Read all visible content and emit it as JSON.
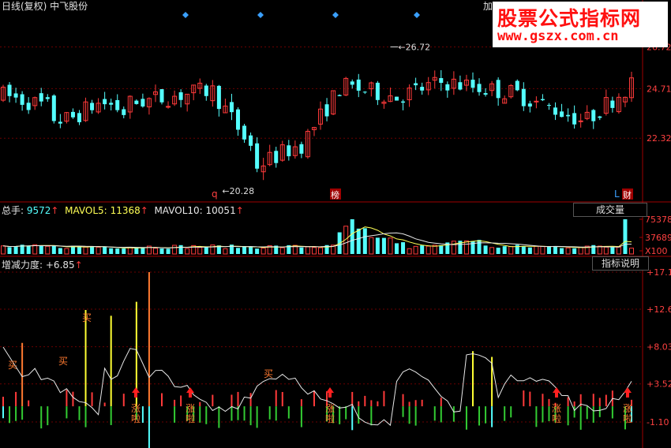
{
  "header": {
    "title": "日线(复权)  中飞股份",
    "zoom_prefix": "加"
  },
  "watermark": {
    "line1": "股票公式指标网",
    "line2": "www.gszx.com.cn"
  },
  "price_panel": {
    "y_ticks": [
      "26.72",
      "24.71",
      "22.32"
    ],
    "y_values": [
      26.72,
      24.71,
      22.32
    ],
    "high_marker": "26.72",
    "low_marker": "20.28",
    "event_markers": [
      "q",
      "榜",
      "L",
      "财"
    ],
    "colors": {
      "up": "#ff3a3a",
      "down": "#54ffff",
      "grid": "#7a0000"
    }
  },
  "volume_panel": {
    "legend_label": "总手:",
    "legend_value": "9572",
    "mavol5_label": "MAVOL5:",
    "mavol5_value": "11368",
    "mavol10_label": "MAVOL10:",
    "mavol10_value": "10051",
    "button_label": "成交量",
    "y_ticks": [
      "75378",
      "37689",
      "X100"
    ]
  },
  "indicator_panel": {
    "legend_label": "增减力度:",
    "legend_value": "+6.85",
    "button_label": "指标说明",
    "y_ticks": [
      "+17.1",
      "+12.6",
      "+8.03",
      "+3.52",
      "-1.10"
    ],
    "buy_label": "买",
    "signal_label": "涨啦"
  },
  "colors": {
    "background": "#000000",
    "up": "#ff3a3a",
    "down": "#54ffff",
    "green": "#33cc33",
    "yellow": "#ffff33",
    "orange": "#ff7a30",
    "marker_blue": "#3aa0ff"
  }
}
